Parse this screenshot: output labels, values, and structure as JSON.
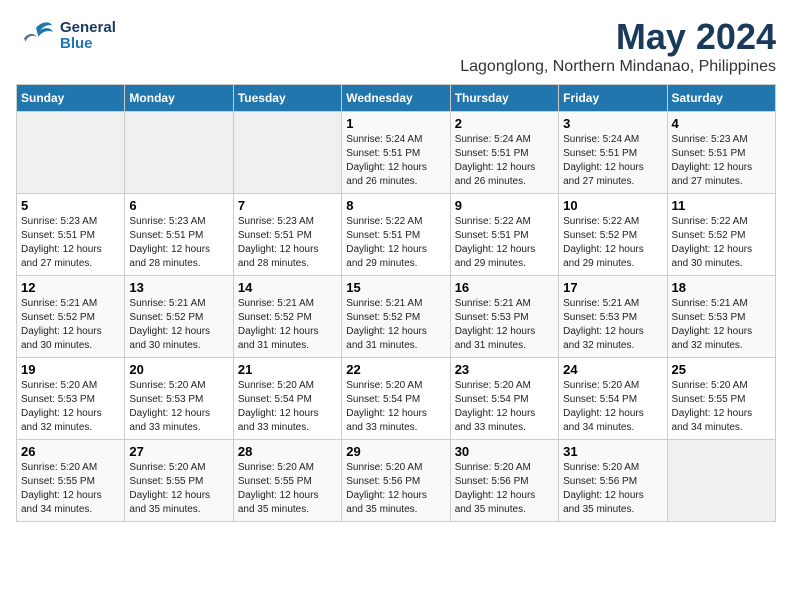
{
  "header": {
    "logo_general": "General",
    "logo_blue": "Blue",
    "main_title": "May 2024",
    "subtitle": "Lagonglong, Northern Mindanao, Philippines"
  },
  "calendar": {
    "days_of_week": [
      "Sunday",
      "Monday",
      "Tuesday",
      "Wednesday",
      "Thursday",
      "Friday",
      "Saturday"
    ],
    "weeks": [
      [
        {
          "day": "",
          "info": ""
        },
        {
          "day": "",
          "info": ""
        },
        {
          "day": "",
          "info": ""
        },
        {
          "day": "1",
          "info": "Sunrise: 5:24 AM\nSunset: 5:51 PM\nDaylight: 12 hours\nand 26 minutes."
        },
        {
          "day": "2",
          "info": "Sunrise: 5:24 AM\nSunset: 5:51 PM\nDaylight: 12 hours\nand 26 minutes."
        },
        {
          "day": "3",
          "info": "Sunrise: 5:24 AM\nSunset: 5:51 PM\nDaylight: 12 hours\nand 27 minutes."
        },
        {
          "day": "4",
          "info": "Sunrise: 5:23 AM\nSunset: 5:51 PM\nDaylight: 12 hours\nand 27 minutes."
        }
      ],
      [
        {
          "day": "5",
          "info": "Sunrise: 5:23 AM\nSunset: 5:51 PM\nDaylight: 12 hours\nand 27 minutes."
        },
        {
          "day": "6",
          "info": "Sunrise: 5:23 AM\nSunset: 5:51 PM\nDaylight: 12 hours\nand 28 minutes."
        },
        {
          "day": "7",
          "info": "Sunrise: 5:23 AM\nSunset: 5:51 PM\nDaylight: 12 hours\nand 28 minutes."
        },
        {
          "day": "8",
          "info": "Sunrise: 5:22 AM\nSunset: 5:51 PM\nDaylight: 12 hours\nand 29 minutes."
        },
        {
          "day": "9",
          "info": "Sunrise: 5:22 AM\nSunset: 5:51 PM\nDaylight: 12 hours\nand 29 minutes."
        },
        {
          "day": "10",
          "info": "Sunrise: 5:22 AM\nSunset: 5:52 PM\nDaylight: 12 hours\nand 29 minutes."
        },
        {
          "day": "11",
          "info": "Sunrise: 5:22 AM\nSunset: 5:52 PM\nDaylight: 12 hours\nand 30 minutes."
        }
      ],
      [
        {
          "day": "12",
          "info": "Sunrise: 5:21 AM\nSunset: 5:52 PM\nDaylight: 12 hours\nand 30 minutes."
        },
        {
          "day": "13",
          "info": "Sunrise: 5:21 AM\nSunset: 5:52 PM\nDaylight: 12 hours\nand 30 minutes."
        },
        {
          "day": "14",
          "info": "Sunrise: 5:21 AM\nSunset: 5:52 PM\nDaylight: 12 hours\nand 31 minutes."
        },
        {
          "day": "15",
          "info": "Sunrise: 5:21 AM\nSunset: 5:52 PM\nDaylight: 12 hours\nand 31 minutes."
        },
        {
          "day": "16",
          "info": "Sunrise: 5:21 AM\nSunset: 5:53 PM\nDaylight: 12 hours\nand 31 minutes."
        },
        {
          "day": "17",
          "info": "Sunrise: 5:21 AM\nSunset: 5:53 PM\nDaylight: 12 hours\nand 32 minutes."
        },
        {
          "day": "18",
          "info": "Sunrise: 5:21 AM\nSunset: 5:53 PM\nDaylight: 12 hours\nand 32 minutes."
        }
      ],
      [
        {
          "day": "19",
          "info": "Sunrise: 5:20 AM\nSunset: 5:53 PM\nDaylight: 12 hours\nand 32 minutes."
        },
        {
          "day": "20",
          "info": "Sunrise: 5:20 AM\nSunset: 5:53 PM\nDaylight: 12 hours\nand 33 minutes."
        },
        {
          "day": "21",
          "info": "Sunrise: 5:20 AM\nSunset: 5:54 PM\nDaylight: 12 hours\nand 33 minutes."
        },
        {
          "day": "22",
          "info": "Sunrise: 5:20 AM\nSunset: 5:54 PM\nDaylight: 12 hours\nand 33 minutes."
        },
        {
          "day": "23",
          "info": "Sunrise: 5:20 AM\nSunset: 5:54 PM\nDaylight: 12 hours\nand 33 minutes."
        },
        {
          "day": "24",
          "info": "Sunrise: 5:20 AM\nSunset: 5:54 PM\nDaylight: 12 hours\nand 34 minutes."
        },
        {
          "day": "25",
          "info": "Sunrise: 5:20 AM\nSunset: 5:55 PM\nDaylight: 12 hours\nand 34 minutes."
        }
      ],
      [
        {
          "day": "26",
          "info": "Sunrise: 5:20 AM\nSunset: 5:55 PM\nDaylight: 12 hours\nand 34 minutes."
        },
        {
          "day": "27",
          "info": "Sunrise: 5:20 AM\nSunset: 5:55 PM\nDaylight: 12 hours\nand 35 minutes."
        },
        {
          "day": "28",
          "info": "Sunrise: 5:20 AM\nSunset: 5:55 PM\nDaylight: 12 hours\nand 35 minutes."
        },
        {
          "day": "29",
          "info": "Sunrise: 5:20 AM\nSunset: 5:56 PM\nDaylight: 12 hours\nand 35 minutes."
        },
        {
          "day": "30",
          "info": "Sunrise: 5:20 AM\nSunset: 5:56 PM\nDaylight: 12 hours\nand 35 minutes."
        },
        {
          "day": "31",
          "info": "Sunrise: 5:20 AM\nSunset: 5:56 PM\nDaylight: 12 hours\nand 35 minutes."
        },
        {
          "day": "",
          "info": ""
        }
      ]
    ]
  }
}
